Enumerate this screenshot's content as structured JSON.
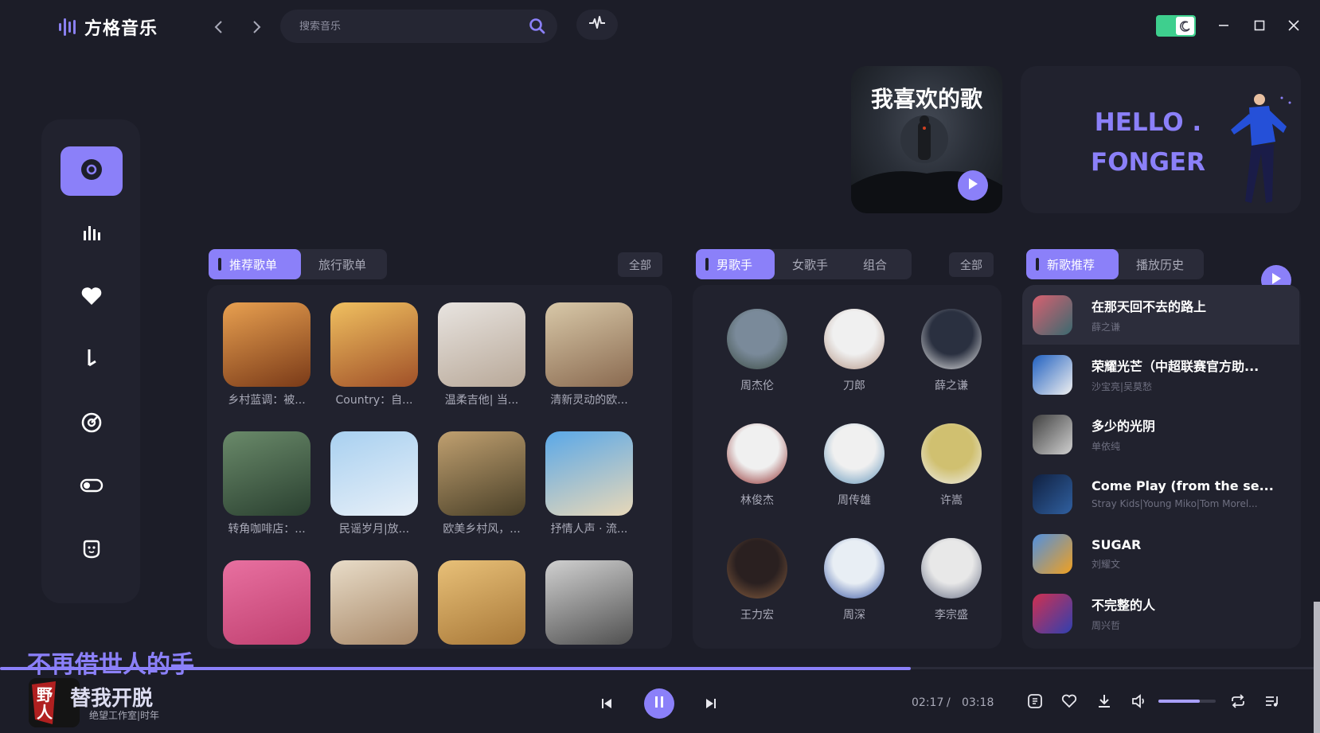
{
  "app": {
    "name": "方格音乐"
  },
  "search": {
    "placeholder": "搜索音乐"
  },
  "banners": {
    "favorite_title": "我喜欢的歌",
    "hello_line1": "HELLO .",
    "hello_line2": "FONGER"
  },
  "sidebar": {
    "items": [
      {
        "icon": "disc-icon",
        "active": true
      },
      {
        "icon": "chart-bars-icon"
      },
      {
        "icon": "heart-icon"
      },
      {
        "icon": "music-note-icon"
      },
      {
        "icon": "target-icon"
      },
      {
        "icon": "toggle-icon"
      },
      {
        "icon": "face-icon"
      }
    ]
  },
  "playlists": {
    "tabs": [
      "推荐歌单",
      "旅行歌单"
    ],
    "all_label": "全部",
    "items": [
      {
        "label": "乡村蓝调：被...",
        "colors": [
          "#e8a050",
          "#7a3a18"
        ]
      },
      {
        "label": "Country：自...",
        "colors": [
          "#f0c060",
          "#a05028"
        ]
      },
      {
        "label": "温柔吉他| 当...",
        "colors": [
          "#e8e4e0",
          "#b8a898"
        ]
      },
      {
        "label": "清新灵动的欧...",
        "colors": [
          "#d8c8a8",
          "#8a6a50"
        ]
      },
      {
        "label": "转角咖啡店：...",
        "colors": [
          "#6a8a6a",
          "#2a4030"
        ]
      },
      {
        "label": "民谣岁月|放...",
        "colors": [
          "#a8d0f0",
          "#e8f0f8"
        ]
      },
      {
        "label": "欧美乡村风，...",
        "colors": [
          "#c0a070",
          "#4a4028"
        ]
      },
      {
        "label": "抒情人声 · 流...",
        "colors": [
          "#5aa8e8",
          "#e8d8b8"
        ]
      },
      {
        "label": "",
        "colors": [
          "#e870a0",
          "#c04070"
        ]
      },
      {
        "label": "",
        "colors": [
          "#e8dcc8",
          "#a88868"
        ]
      },
      {
        "label": "",
        "colors": [
          "#e8c078",
          "#a87838"
        ]
      },
      {
        "label": "",
        "colors": [
          "#d0d0d0",
          "#505050"
        ]
      }
    ]
  },
  "artists": {
    "tabs": [
      "男歌手",
      "女歌手",
      "组合"
    ],
    "all_label": "全部",
    "items": [
      {
        "name": "周杰伦",
        "colors": [
          "#7a8a9a",
          "#3a4a40"
        ]
      },
      {
        "name": "刀郎",
        "colors": [
          "#f0f0f0",
          "#b09080"
        ]
      },
      {
        "name": "薛之谦",
        "colors": [
          "#2a3040",
          "#f0f0f0"
        ]
      },
      {
        "name": "林俊杰",
        "colors": [
          "#f0f0f0",
          "#8a2020"
        ]
      },
      {
        "name": "周传雄",
        "colors": [
          "#f0f0f0",
          "#5a90b8"
        ]
      },
      {
        "name": "许嵩",
        "colors": [
          "#d0c070",
          "#f0f0f0"
        ]
      },
      {
        "name": "王力宏",
        "colors": [
          "#2a2020",
          "#8a6040"
        ]
      },
      {
        "name": "周深",
        "colors": [
          "#e8eef4",
          "#3050a0"
        ]
      },
      {
        "name": "李宗盛",
        "colors": [
          "#e8e8e8",
          "#606880"
        ]
      }
    ]
  },
  "songs": {
    "tabs": [
      "新歌推荐",
      "播放历史"
    ],
    "items": [
      {
        "title": "在那天回不去的路上",
        "artist": "薛之谦",
        "colors": [
          "#d86070",
          "#3a6a70"
        ],
        "active": true
      },
      {
        "title": "荣耀光芒（中超联赛官方助...",
        "artist": "沙宝亮|吴莫愁",
        "colors": [
          "#2060c0",
          "#f0f0f0"
        ]
      },
      {
        "title": "多少的光阴",
        "artist": "单依纯",
        "colors": [
          "#404040",
          "#d0d0d0"
        ]
      },
      {
        "title": "Come Play (from the se...",
        "artist": "Stray Kids|Young Miko|Tom Morel...",
        "colors": [
          "#102040",
          "#3060a0"
        ]
      },
      {
        "title": "SUGAR",
        "artist": "刘耀文",
        "colors": [
          "#5090e0",
          "#f0a020"
        ]
      },
      {
        "title": "不完整的人",
        "artist": "周兴哲",
        "colors": [
          "#d03050",
          "#3040b0"
        ]
      }
    ]
  },
  "player": {
    "lyric": "不再借世人的手",
    "title": "替我开脱",
    "artist": "绝望工作室|时年",
    "current_time": "02:17",
    "separator": "/",
    "total_time": "03:18",
    "progress": 0.69,
    "volume": 0.72,
    "cover_text": "野人"
  },
  "colors": {
    "accent": "#8b80f9",
    "background": "#1c1d28",
    "panel": "#21222e"
  }
}
